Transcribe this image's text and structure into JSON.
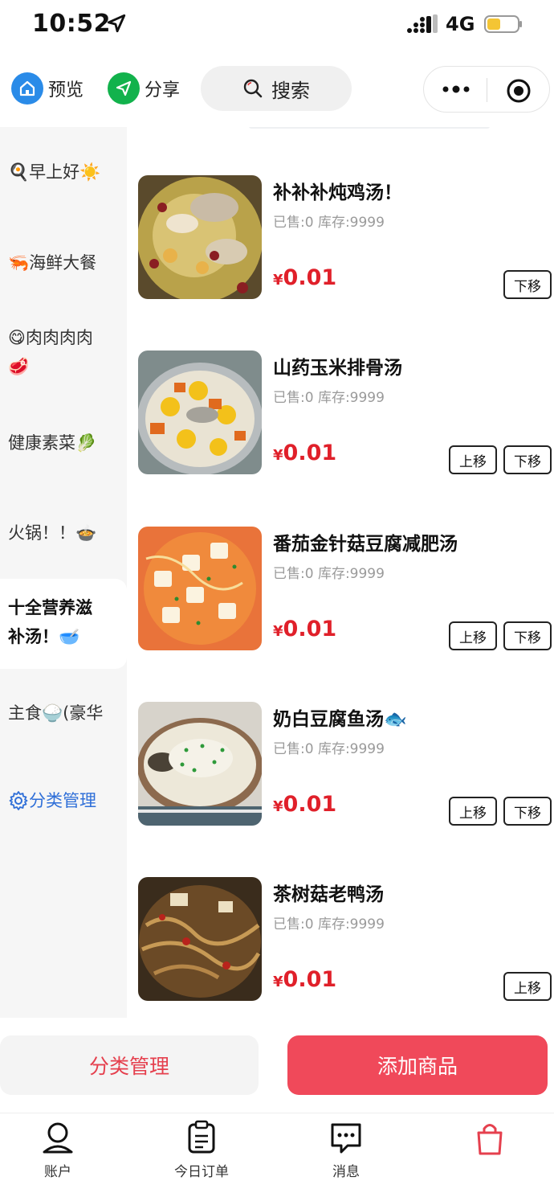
{
  "status_bar": {
    "time": "10:52",
    "network": "4G"
  },
  "top_bar": {
    "preview_label": "预览",
    "share_label": "分享",
    "search_label": "搜索"
  },
  "sidebar": {
    "items": [
      {
        "label": "🍳早上好☀️",
        "active": false
      },
      {
        "label": "🦐海鲜大餐",
        "active": false
      },
      {
        "label": "😋肉肉肉肉",
        "label2": "🥩",
        "active": false
      },
      {
        "label": "健康素菜🥬",
        "active": false
      },
      {
        "label": "火锅！！🍲",
        "active": false
      },
      {
        "label": "十全营养滋",
        "label2": "补汤！🥣",
        "active": true
      },
      {
        "label": "主食🍚(豪华",
        "active": false
      }
    ],
    "manage_label": "分类管理"
  },
  "products": [
    {
      "name": "补补补炖鸡汤！",
      "sold": "已售:0",
      "stock": "库存:9999",
      "currency": "¥",
      "price": "0.01",
      "up_label": "",
      "down_label": "下移"
    },
    {
      "name": "山药玉米排骨汤",
      "sold": "已售:0",
      "stock": "库存:9999",
      "currency": "¥",
      "price": "0.01",
      "up_label": "上移",
      "down_label": "下移"
    },
    {
      "name": "番茄金针菇豆腐减肥汤",
      "sold": "已售:0",
      "stock": "库存:9999",
      "currency": "¥",
      "price": "0.01",
      "up_label": "上移",
      "down_label": "下移"
    },
    {
      "name": "奶白豆腐鱼汤🐟",
      "sold": "已售:0",
      "stock": "库存:9999",
      "currency": "¥",
      "price": "0.01",
      "up_label": "上移",
      "down_label": "下移"
    },
    {
      "name": "茶树菇老鸭汤",
      "sold": "已售:0",
      "stock": "库存:9999",
      "currency": "¥",
      "price": "0.01",
      "up_label": "上移",
      "down_label": ""
    }
  ],
  "action_bar": {
    "category_manage_label": "分类管理",
    "add_product_label": "添加商品"
  },
  "tab_bar": {
    "tabs": [
      {
        "label": "账户",
        "icon": "user-icon"
      },
      {
        "label": "今日订单",
        "icon": "clipboard-icon"
      },
      {
        "label": "消息",
        "icon": "chat-icon"
      },
      {
        "label": "",
        "icon": "shopping-bag-icon"
      }
    ]
  },
  "colors": {
    "price": "#e0202a",
    "primary": "#f0495a",
    "link": "#2f6fd8",
    "preview_icon": "#2a8be8",
    "share_icon": "#12b24c"
  }
}
